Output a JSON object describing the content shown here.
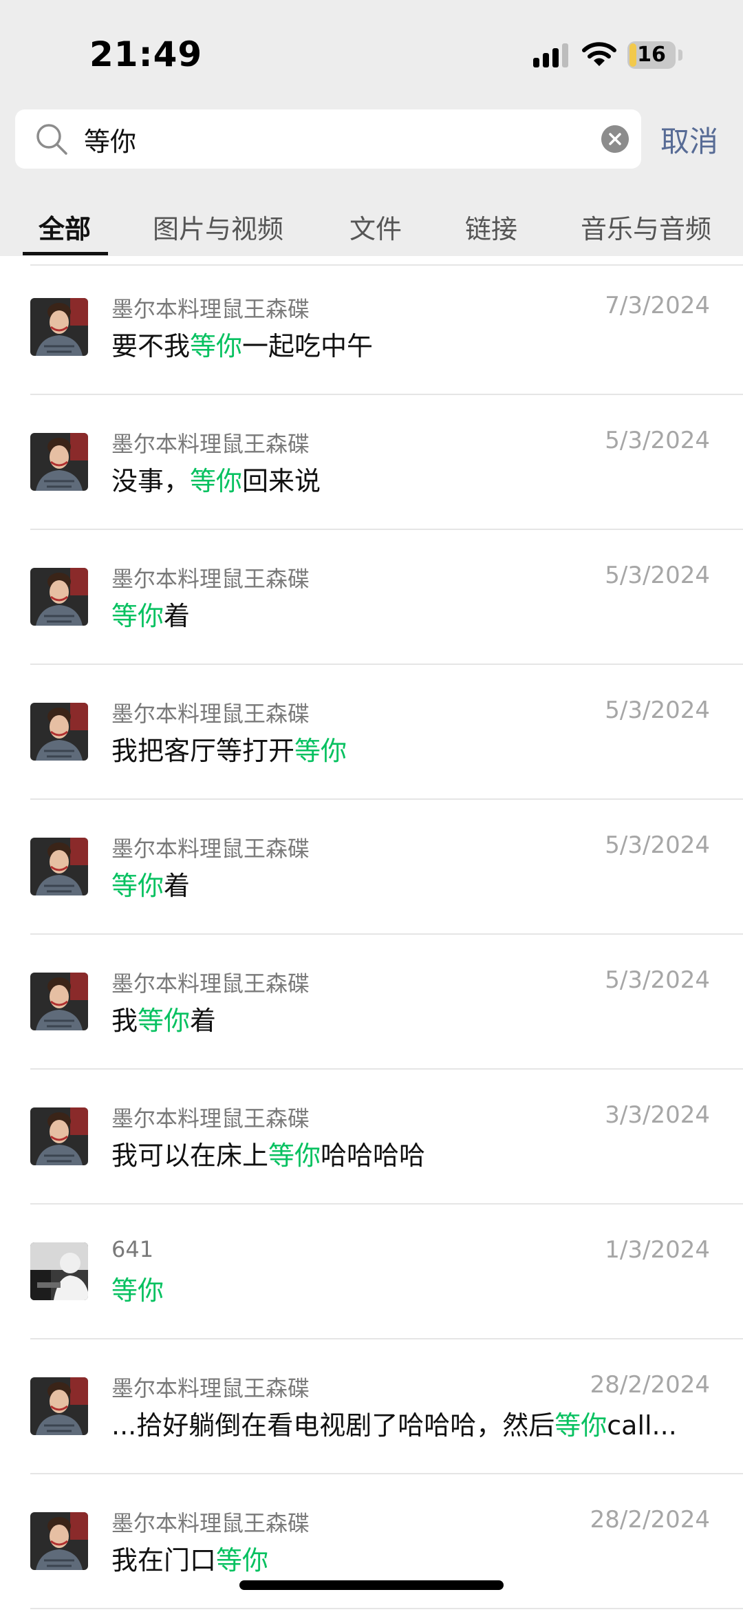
{
  "status_bar": {
    "time": "21:49",
    "battery": "16",
    "battery_level": 0.16,
    "icons": [
      "signal-icon",
      "wifi-icon",
      "battery-icon"
    ]
  },
  "search": {
    "query": "等你",
    "cancel_label": "取消"
  },
  "tabs": [
    {
      "label": "全部",
      "active": true
    },
    {
      "label": "图片与视频",
      "active": false
    },
    {
      "label": "文件",
      "active": false
    },
    {
      "label": "链接",
      "active": false
    },
    {
      "label": "音乐与音频",
      "active": false
    }
  ],
  "colors": {
    "highlight": "#07c160",
    "cancel": "#576b95",
    "header_bg": "#ededed"
  },
  "results": [
    {
      "name": "墨尔本料理鼠王森碟",
      "date": "7/3/2024",
      "avatar": "woman-portrait",
      "msg": [
        {
          "t": "要不我"
        },
        {
          "t": "等你",
          "hl": true
        },
        {
          "t": "一起吃中午"
        }
      ]
    },
    {
      "name": "墨尔本料理鼠王森碟",
      "date": "5/3/2024",
      "avatar": "woman-portrait",
      "msg": [
        {
          "t": "没事，"
        },
        {
          "t": "等你",
          "hl": true
        },
        {
          "t": "回来说"
        }
      ]
    },
    {
      "name": "墨尔本料理鼠王森碟",
      "date": "5/3/2024",
      "avatar": "woman-portrait",
      "msg": [
        {
          "t": "等你",
          "hl": true
        },
        {
          "t": "着"
        }
      ]
    },
    {
      "name": "墨尔本料理鼠王森碟",
      "date": "5/3/2024",
      "avatar": "woman-portrait",
      "msg": [
        {
          "t": "我把客厅等打开"
        },
        {
          "t": "等你",
          "hl": true
        }
      ]
    },
    {
      "name": "墨尔本料理鼠王森碟",
      "date": "5/3/2024",
      "avatar": "woman-portrait",
      "msg": [
        {
          "t": "等你",
          "hl": true
        },
        {
          "t": "着"
        }
      ]
    },
    {
      "name": "墨尔本料理鼠王森碟",
      "date": "5/3/2024",
      "avatar": "woman-portrait",
      "msg": [
        {
          "t": "我"
        },
        {
          "t": "等你",
          "hl": true
        },
        {
          "t": "着"
        }
      ]
    },
    {
      "name": "墨尔本料理鼠王森碟",
      "date": "3/3/2024",
      "avatar": "woman-portrait",
      "msg": [
        {
          "t": "我可以在床上"
        },
        {
          "t": "等你",
          "hl": true
        },
        {
          "t": "哈哈哈哈"
        }
      ]
    },
    {
      "name": "641",
      "date": "1/3/2024",
      "avatar": "bw-photo",
      "msg": [
        {
          "t": "等你",
          "hl": true
        }
      ]
    },
    {
      "name": "墨尔本料理鼠王森碟",
      "date": "28/2/2024",
      "avatar": "woman-portrait",
      "msg": [
        {
          "t": "...拾好躺倒在看电视剧了哈哈哈，然后"
        },
        {
          "t": "等你",
          "hl": true
        },
        {
          "t": "call..."
        }
      ]
    },
    {
      "name": "墨尔本料理鼠王森碟",
      "date": "28/2/2024",
      "avatar": "woman-portrait",
      "msg": [
        {
          "t": "我在门口"
        },
        {
          "t": "等你",
          "hl": true
        }
      ]
    }
  ]
}
